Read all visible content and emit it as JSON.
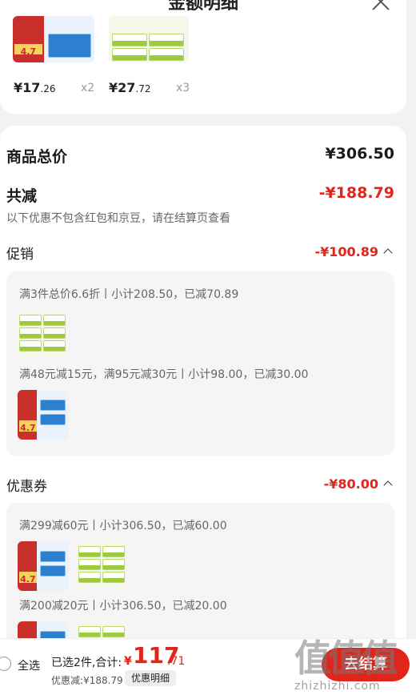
{
  "sheet": {
    "title": "金额明细"
  },
  "items": [
    {
      "price_main": "¥17",
      "price_decimal": ".26",
      "qty": "x2"
    },
    {
      "price_main": "¥27",
      "price_decimal": ".72",
      "qty": "x3"
    }
  ],
  "summary": {
    "total_label": "商品总价",
    "total_value": "¥306.50",
    "discount_label": "共减",
    "discount_value": "-¥188.79",
    "note": "以下优惠不包含红包和京豆，请在结算页查看"
  },
  "promotion": {
    "title": "促销",
    "amount": "-¥100.89",
    "rules": [
      "满3件总价6.6折丨小计208.50，已减70.89",
      "满48元减15元，满95元减30元丨小计98.00，已减30.00"
    ]
  },
  "coupon": {
    "title": "优惠券",
    "amount": "-¥80.00",
    "rules": [
      "满299减60元丨小计306.50，已减60.00",
      "满200减20元丨小计306.50，已减20.00"
    ]
  },
  "product_badge": "4.7",
  "bottom": {
    "select_all": "全选",
    "selected_text": "已选2件,合计:",
    "currency": "¥",
    "total_int": "117",
    "total_dec": ".71",
    "discount": "优惠减:¥188.79",
    "detail_button": "优惠明细",
    "checkout": "去结算"
  },
  "watermark": {
    "mark": "值值值",
    "text": "zhizhizhi.com"
  },
  "colors": {
    "accent": "#e1251b",
    "panel": "#f5f5f5",
    "background": "#f2f2f2"
  }
}
